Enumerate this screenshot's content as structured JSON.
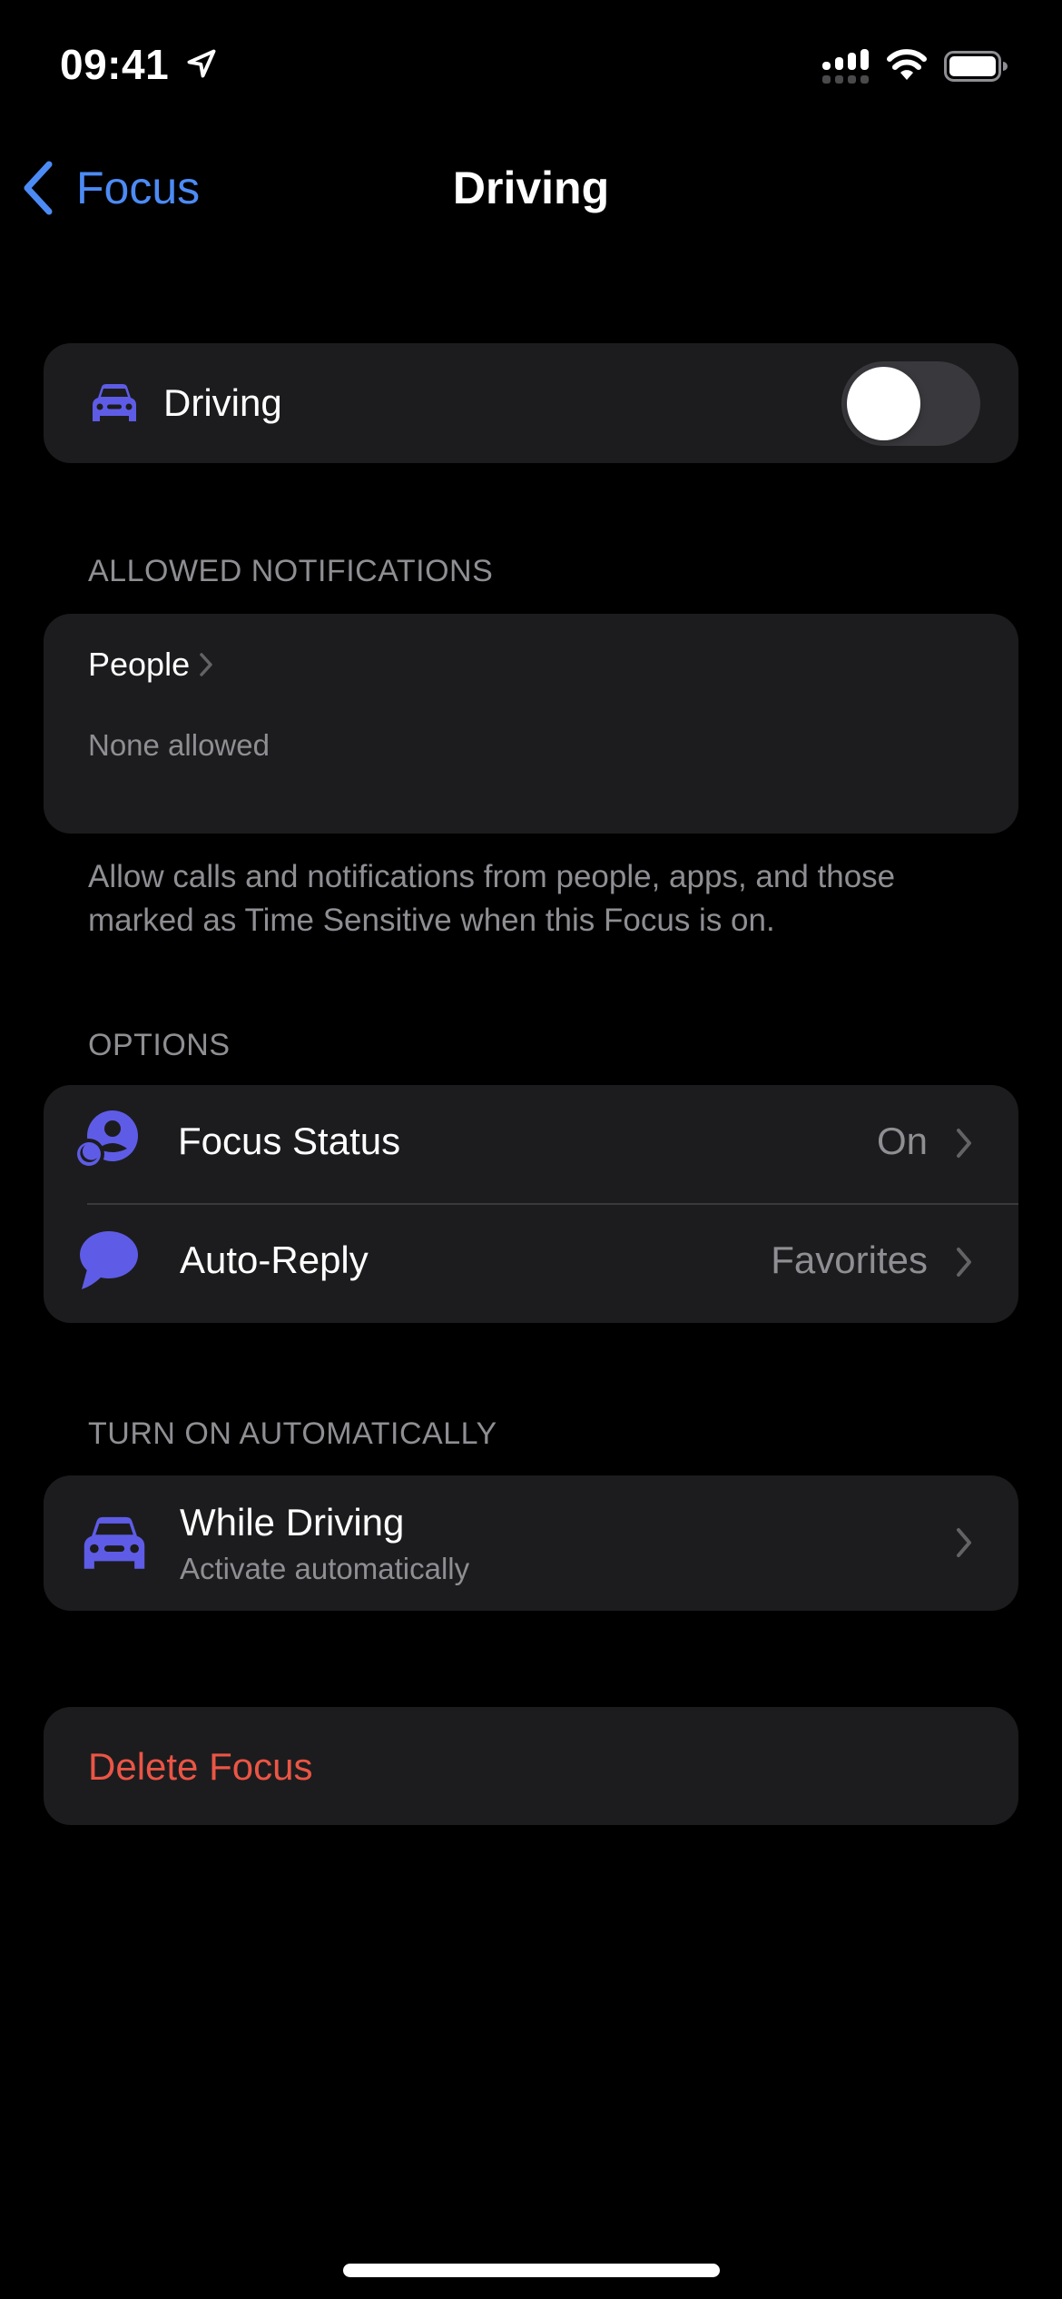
{
  "status_bar": {
    "time": "09:41",
    "icons": [
      "location-arrow-icon",
      "cellular-signal-icon",
      "wifi-icon",
      "battery-icon"
    ]
  },
  "nav": {
    "back_label": "Focus",
    "back_icon": "chevron-left-icon",
    "title": "Driving"
  },
  "focus_toggle": {
    "icon": "car-icon",
    "label": "Driving",
    "enabled": false
  },
  "allowed_notifications": {
    "header": "ALLOWED NOTIFICATIONS",
    "people_label": "People",
    "people_value": "None allowed",
    "footer": "Allow calls and notifications from people, apps, and those marked as Time Sensitive when this Focus is on."
  },
  "options": {
    "header": "OPTIONS",
    "rows": [
      {
        "icon": "focus-status-icon",
        "label": "Focus Status",
        "value": "On"
      },
      {
        "icon": "speech-bubble-icon",
        "label": "Auto-Reply",
        "value": "Favorites"
      }
    ]
  },
  "turn_on_automatically": {
    "header": "TURN ON AUTOMATICALLY",
    "row": {
      "icon": "car-icon",
      "title": "While Driving",
      "subtitle": "Activate automatically"
    }
  },
  "delete": {
    "label": "Delete Focus"
  },
  "colors": {
    "accent": "#4c8bf5",
    "icon_tint": "#5e5ce6",
    "destructive": "#eb5545",
    "card_bg": "#1c1c1e",
    "secondary_text": "#8e8e93"
  }
}
